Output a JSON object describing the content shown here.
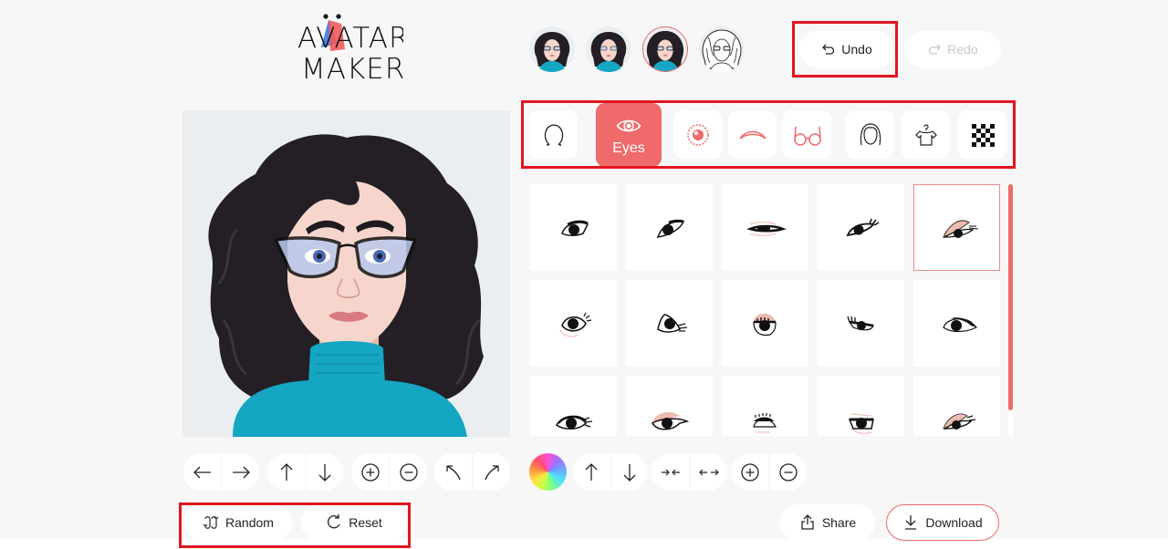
{
  "app": {
    "logo_line1": "AVATAR",
    "logo_line2": "MAKER"
  },
  "history": {
    "items": [
      {
        "label": "avatar-history-1",
        "variant": "color"
      },
      {
        "label": "avatar-history-2",
        "variant": "color"
      },
      {
        "label": "avatar-history-3",
        "variant": "color",
        "active": true
      },
      {
        "label": "avatar-history-4",
        "variant": "sketch"
      }
    ]
  },
  "toolbar": {
    "undo_label": "Undo",
    "redo_label": "Redo",
    "undo_icon": "undo-icon",
    "redo_icon": "redo-icon"
  },
  "categories": {
    "active": "Eyes",
    "items": [
      {
        "name": "face-shape",
        "icon": "face-outline-icon"
      },
      {
        "name": "eyes",
        "icon": "eye-icon",
        "label": "Eyes",
        "active": true
      },
      {
        "name": "iris",
        "icon": "iris-icon"
      },
      {
        "name": "eyebrows",
        "icon": "eyebrow-icon"
      },
      {
        "name": "glasses",
        "icon": "glasses-icon"
      },
      {
        "name": "hair",
        "icon": "hair-icon"
      },
      {
        "name": "clothes",
        "icon": "shirt-hanger-icon"
      },
      {
        "name": "background",
        "icon": "checkerboard-icon"
      }
    ]
  },
  "options": {
    "selected_index": 4,
    "count_visible": 15,
    "scroll_position_fraction": 0.0,
    "scroll_visible_fraction": 0.9
  },
  "left_controls": [
    {
      "group": "horizontal",
      "buttons": [
        {
          "icon": "arrow-left-icon"
        },
        {
          "icon": "arrow-right-icon"
        }
      ]
    },
    {
      "group": "vertical",
      "buttons": [
        {
          "icon": "arrow-up-icon"
        },
        {
          "icon": "arrow-down-icon"
        }
      ]
    },
    {
      "group": "scale",
      "buttons": [
        {
          "icon": "zoom-in-icon"
        },
        {
          "icon": "zoom-out-icon"
        }
      ]
    },
    {
      "group": "rotate",
      "buttons": [
        {
          "icon": "rotate-left-icon"
        },
        {
          "icon": "rotate-right-icon"
        }
      ]
    }
  ],
  "right_controls": [
    {
      "group": "color",
      "buttons": [
        {
          "icon": "color-wheel-icon"
        }
      ]
    },
    {
      "group": "vertical",
      "buttons": [
        {
          "icon": "arrow-up-icon"
        },
        {
          "icon": "arrow-down-icon"
        }
      ]
    },
    {
      "group": "spacing",
      "buttons": [
        {
          "icon": "narrow-icon"
        },
        {
          "icon": "widen-icon"
        }
      ]
    },
    {
      "group": "scale",
      "buttons": [
        {
          "icon": "zoom-in-icon"
        },
        {
          "icon": "zoom-out-icon"
        }
      ]
    }
  ],
  "actions": {
    "random_label": "Random",
    "reset_label": "Reset",
    "share_label": "Share",
    "download_label": "Download"
  },
  "colors": {
    "accent": "#ef6a6a",
    "highlight_box": "#e0161f",
    "page_bg": "#f7f7f7",
    "preview_bg": "#ebeef0",
    "sweater": "#14a6c2",
    "hair": "#231f24",
    "skin": "#f6d6cc"
  }
}
